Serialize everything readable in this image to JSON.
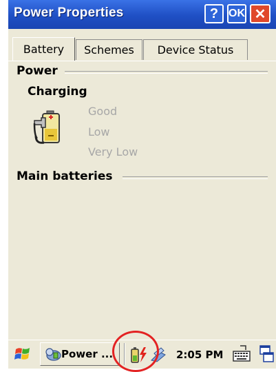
{
  "window": {
    "title": "Power Properties",
    "help_label": "?",
    "ok_label": "OK",
    "close_label": "✕"
  },
  "tabs": [
    {
      "label": "Battery",
      "selected": true
    },
    {
      "label": "Schemes",
      "selected": false
    },
    {
      "label": "Device Status",
      "selected": false
    }
  ],
  "power": {
    "heading": "Power",
    "charging_label": "Charging",
    "levels": [
      "Good",
      "Low",
      "Very Low"
    ],
    "battery_icon": "battery-charging-icon"
  },
  "main_batteries": {
    "heading": "Main batteries"
  },
  "taskbar": {
    "start_icon": "windows-flag-icon",
    "task_label": "Power ...",
    "task_icon": "power-properties-icon",
    "tray_icons": [
      "battery-charging-icon",
      "connectivity-icon"
    ],
    "clock": "2:05 PM",
    "keyboard_icon": "keyboard-icon",
    "window_icon": "window-switch-icon"
  },
  "colors": {
    "titlebar": "#1f4fc4",
    "close_button": "#e0492b",
    "dialog_bg": "#ece9d8",
    "disabled_text": "#a7a7a7",
    "highlight_circle": "#e32222"
  }
}
